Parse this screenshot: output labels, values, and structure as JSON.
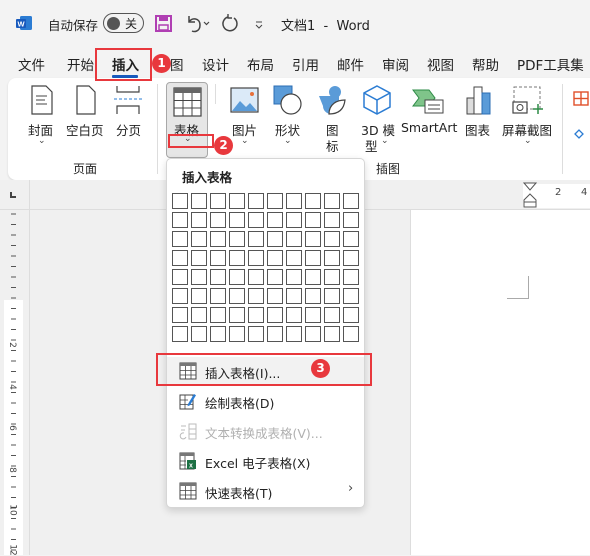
{
  "titlebar": {
    "autosave_label": "自动保存",
    "autosave_state": "关",
    "title": "文档1  -  Word"
  },
  "tabs": [
    {
      "label": "文件"
    },
    {
      "label": "开始"
    },
    {
      "label": "插入",
      "active": true
    },
    {
      "label": "图"
    },
    {
      "label": "设计"
    },
    {
      "label": "布局"
    },
    {
      "label": "引用"
    },
    {
      "label": "邮件"
    },
    {
      "label": "审阅"
    },
    {
      "label": "视图"
    },
    {
      "label": "帮助"
    },
    {
      "label": "PDF工具集"
    }
  ],
  "ribbon": {
    "pages_group": {
      "label": "页面",
      "buttons": [
        "封面",
        "空白页",
        "分页"
      ]
    },
    "table_button": "表格",
    "illustrations_group": {
      "label": "插图",
      "buttons": [
        "图片",
        "形状",
        "图",
        "标",
        "3D 模",
        "型",
        "SmartArt",
        "图表",
        "屏幕截图"
      ]
    }
  },
  "annotations": [
    "1",
    "2",
    "3"
  ],
  "table_menu": {
    "title": "插入表格",
    "grid": {
      "columns": 10,
      "rows": 8
    },
    "items": [
      {
        "label": "插入表格(I)...",
        "icon": "table-icon",
        "enabled": true,
        "highlighted": true
      },
      {
        "label": "绘制表格(D)",
        "icon": "draw-table-icon",
        "enabled": true
      },
      {
        "label": "文本转换成表格(V)...",
        "icon": "convert-text-icon",
        "enabled": false
      },
      {
        "label": "Excel 电子表格(X)",
        "icon": "excel-icon",
        "enabled": true
      },
      {
        "label": "快速表格(T)",
        "icon": "quick-table-icon",
        "enabled": true,
        "submenu": true
      }
    ]
  },
  "ruler": {
    "top_ticks": [
      "2",
      "4"
    ],
    "left_ticks": [
      "2",
      "4",
      "6",
      "8",
      "10",
      "12"
    ]
  },
  "colors": {
    "accent": "#185abd",
    "annotation_red": "#e8383d",
    "save_icon": "#b03fb3"
  }
}
